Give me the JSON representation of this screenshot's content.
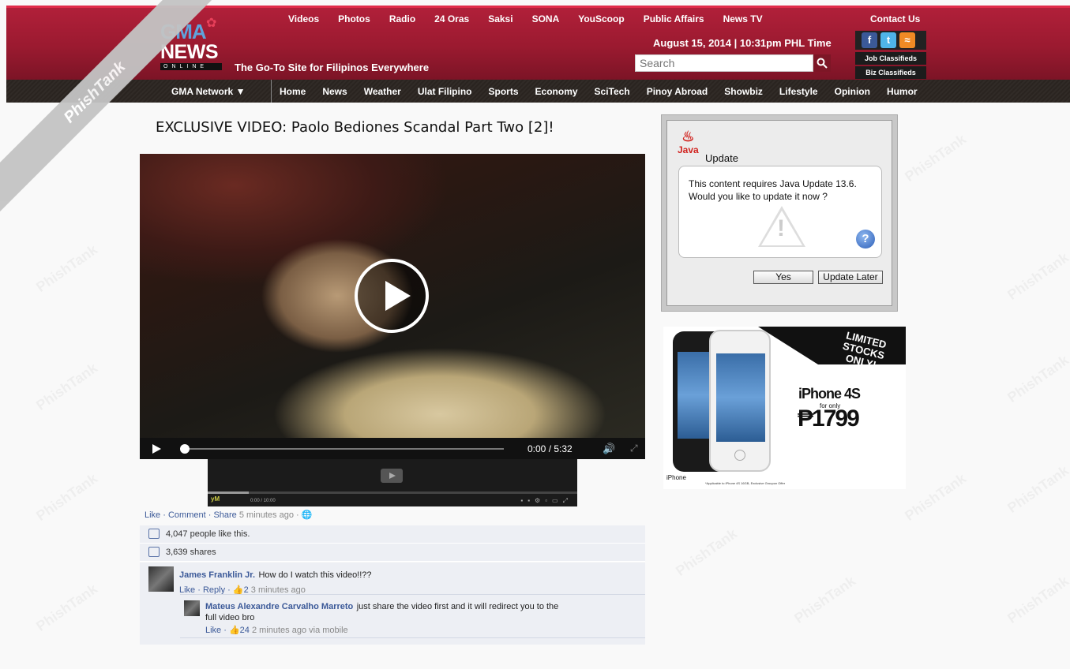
{
  "header": {
    "logo_gma": "GMA",
    "logo_news": "NEWS",
    "logo_online": "ONLINE",
    "tagline": "The Go-To Site for Filipinos Everywhere",
    "top_nav": [
      "Videos",
      "Photos",
      "Radio",
      "24 Oras",
      "Saksi",
      "SONA",
      "YouScoop",
      "Public Affairs",
      "News TV"
    ],
    "contact": "Contact Us",
    "date": "August 15, 2014 | 10:31pm PHL Time",
    "search_placeholder": "Search",
    "social_icons": [
      "facebook-icon",
      "twitter-icon",
      "rss-icon"
    ],
    "job_classifieds": "Job Classifieds",
    "biz_classifieds": "Biz Classifieds"
  },
  "navbar": {
    "network": "GMA Network ▼",
    "items": [
      "Home",
      "News",
      "Weather",
      "Ulat Filipino",
      "Sports",
      "Economy",
      "SciTech",
      "Pinoy Abroad",
      "Showbiz",
      "Lifestyle",
      "Opinion",
      "Humor"
    ]
  },
  "ribbon": "PhishTank",
  "article": {
    "title": "EXCLUSIVE VIDEO: Paolo Bediones Scandal Part Two [2]!",
    "video_time": "0:00 / 5:32",
    "mini_time": "0:00 / 10:00",
    "mini_logo": "yM",
    "progress": 0
  },
  "facebook": {
    "like": "Like",
    "comment": "Comment",
    "share": "Share",
    "post_time": "5 minutes ago",
    "likes": "4,047 people like this.",
    "shares": "3,639 shares",
    "comments": [
      {
        "name": "James Franklin Jr.",
        "text": "How do I watch this video!!??",
        "like": "Like",
        "reply": "Reply",
        "likes": "2",
        "time": "3 minutes ago"
      },
      {
        "name": "Mateus Alexandre Carvalho Marreto",
        "text": "just share the video first and it will redirect you to the",
        "text2": "full video bro",
        "like": "Like",
        "likes": "24",
        "time": "2 minutes ago via mobile"
      }
    ]
  },
  "java_dialog": {
    "logo": "Java",
    "title": "Update",
    "message_line1": "This content requires Java Update 13.6.",
    "message_line2": "Would you like to update it now ?",
    "yes_label": "Yes",
    "later_label": "Update Later"
  },
  "ad": {
    "banner": "LIMITED STOCKS ONLY!",
    "model": "iPhone 4S",
    "for_only": "for only",
    "price": "₱1799",
    "iphone_label": " iPhone",
    "fine_print": "*Applicable to iPhone 4S 16GB, Exclusive Groupon Offer"
  }
}
